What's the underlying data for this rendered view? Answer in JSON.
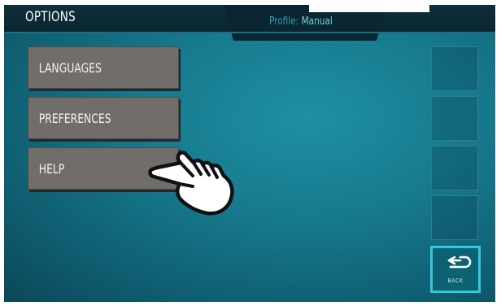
{
  "header": {
    "title": "OPTIONS",
    "profile_label": "Profile:",
    "profile_value": "Manual"
  },
  "menu": {
    "items": [
      {
        "label": "LANGUAGES"
      },
      {
        "label": "PREFERENCES"
      },
      {
        "label": "HELP"
      }
    ]
  },
  "side_panel": {
    "slots": [
      "",
      "",
      "",
      ""
    ],
    "back_label": "BACK"
  },
  "icons": {
    "pointer": "pointing-hand-icon",
    "back": "return-arrow-icon"
  },
  "colors": {
    "background": "#177a8e",
    "header": "#0a2630",
    "button": "#716e69",
    "accent": "#36c7df"
  }
}
